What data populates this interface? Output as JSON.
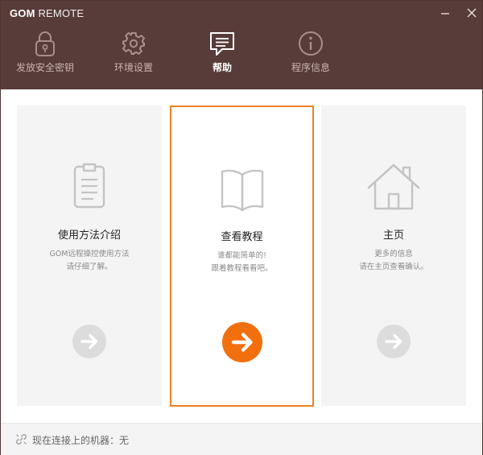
{
  "app": {
    "title_bold": "GOM",
    "title_light": "REMOTE",
    "minimize_symbol": "—",
    "close_symbol": "✕"
  },
  "tabs": [
    {
      "label": "发放安全密钥",
      "icon": "padlock-icon",
      "active": false
    },
    {
      "label": "环境设置",
      "icon": "gear-icon",
      "active": false
    },
    {
      "label": "帮助",
      "icon": "chat-bubble-icon",
      "active": true
    },
    {
      "label": "程序信息",
      "icon": "info-icon",
      "active": false
    }
  ],
  "cards": [
    {
      "title": "使用方法介绍",
      "desc": [
        "GOM远程操控使用方法",
        "请仔细了解。"
      ],
      "icon": "clipboard-icon",
      "selected": false
    },
    {
      "title": "查看教程",
      "desc": [
        "谁都能简单的!",
        "跟着教程看看吧。"
      ],
      "icon": "book-icon",
      "selected": true
    },
    {
      "title": "主页",
      "desc": [
        "更多的信息",
        "请在主页查看确认。"
      ],
      "icon": "home-icon",
      "selected": false
    }
  ],
  "footer": {
    "status": "现在连接上的机器：无",
    "icon": "link-icon"
  },
  "colors": {
    "header_bg": "#583c3a",
    "accent": "#f26f0e",
    "selected_border": "#f08120"
  }
}
